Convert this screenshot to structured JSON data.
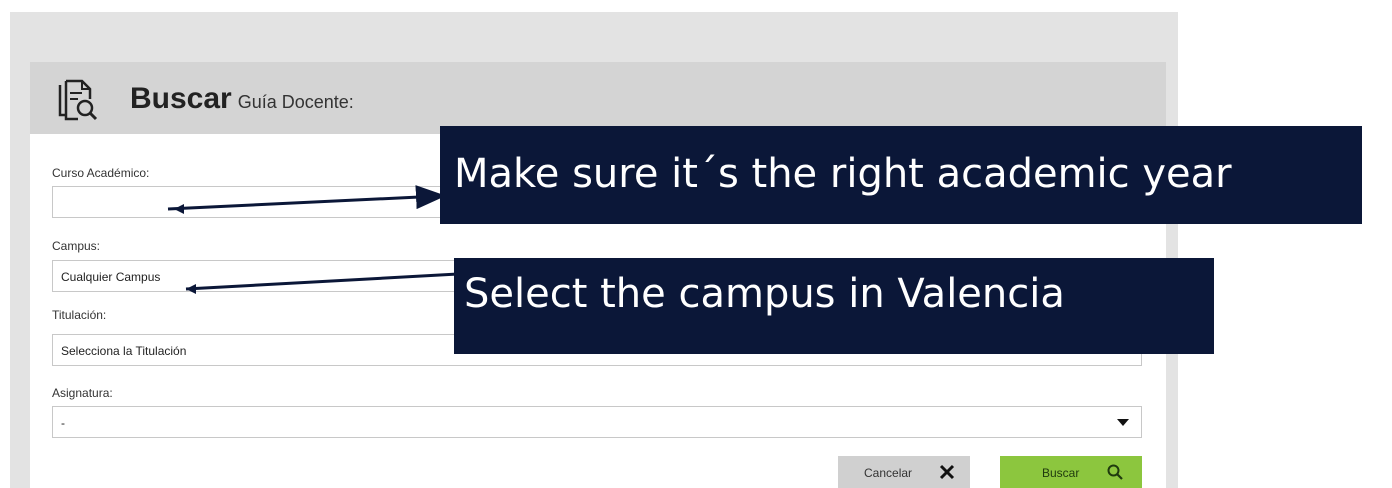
{
  "header": {
    "title": "Buscar",
    "subtitle": "Guía Docente:",
    "icon": "document-search-icon"
  },
  "form": {
    "curso": {
      "label": "Curso Académico:",
      "value": ""
    },
    "campus": {
      "label": "Campus:",
      "value": "Cualquier Campus"
    },
    "titulacion": {
      "label": "Titulación:",
      "value": "Selecciona la Titulación"
    },
    "asignatura": {
      "label": "Asignatura:",
      "value": "-"
    }
  },
  "buttons": {
    "cancel_label": "Cancelar",
    "cancel_icon": "close-icon",
    "search_label": "Buscar",
    "search_icon": "search-icon"
  },
  "callouts": {
    "academic_year": "Make sure it´s the right academic year",
    "campus": "Select the campus in Valencia"
  },
  "colors": {
    "callout_bg": "#0b1738",
    "search_button": "#8cc63e",
    "cancel_button": "#d0d0d0",
    "header_bg": "#d4d4d4"
  }
}
